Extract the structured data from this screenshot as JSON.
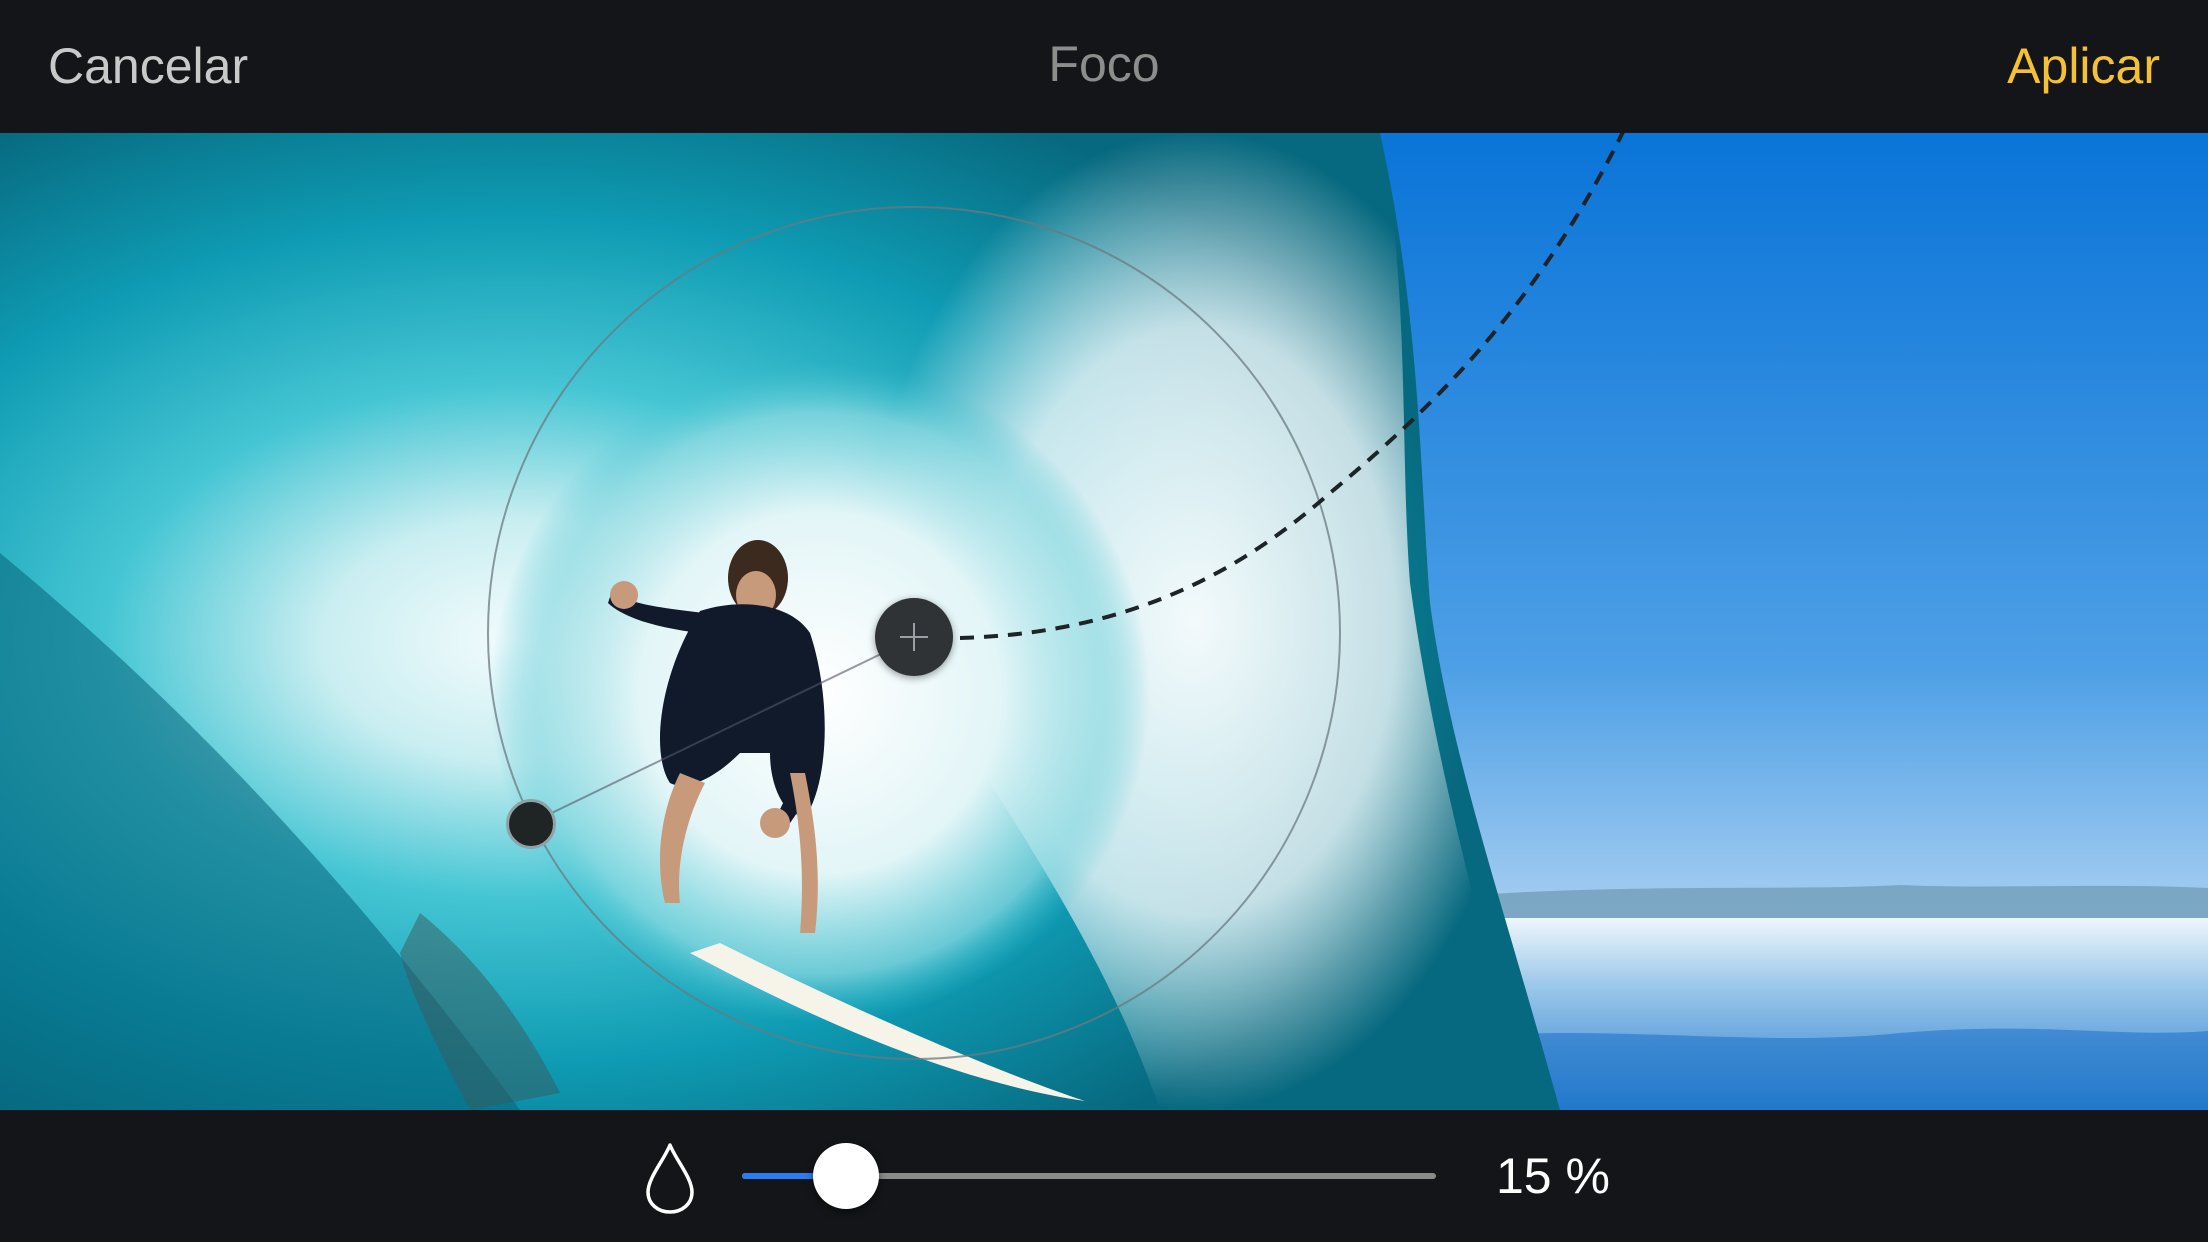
{
  "header": {
    "cancel_label": "Cancelar",
    "title": "Foco",
    "apply_label": "Aplicar"
  },
  "colors": {
    "apply_accent": "#f4c035",
    "slider_fill": "#2b7cf2",
    "background": "#141518"
  },
  "focus_tool": {
    "center_handle_icon": "crosshair-icon",
    "radius_handle_icon": "handle-icon"
  },
  "blur_control": {
    "icon": "drop-icon",
    "value_fraction": 0.15,
    "value_label": "15 %"
  }
}
